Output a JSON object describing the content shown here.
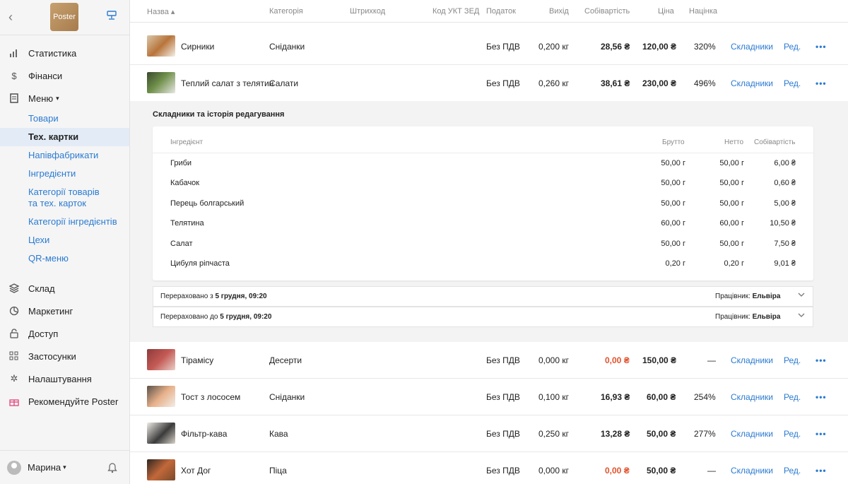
{
  "sidebar": {
    "logo": "Poster",
    "items": [
      {
        "label": "Статистика"
      },
      {
        "label": "Фінанси"
      },
      {
        "label": "Меню"
      },
      {
        "label": "Склад"
      },
      {
        "label": "Маркетинг"
      },
      {
        "label": "Доступ"
      },
      {
        "label": "Застосунки"
      },
      {
        "label": "Налаштування"
      },
      {
        "label": "Рекомендуйте Poster"
      }
    ],
    "menu_sub": [
      {
        "label": "Товари"
      },
      {
        "label": "Тех. картки"
      },
      {
        "label": "Напівфабрикати"
      },
      {
        "label": "Інгредієнти"
      },
      {
        "label": "Категорії товарів та тех. карток"
      },
      {
        "label": "Категорії інгредієнтів"
      },
      {
        "label": "Цехи"
      },
      {
        "label": "QR-меню"
      }
    ],
    "user": "Марина",
    "menu_caret": "▾",
    "user_caret": "▾"
  },
  "table": {
    "columns": {
      "name": "Назва ▴",
      "category": "Категорія",
      "barcode": "Штрихкод",
      "ukt": "Код УКТ ЗЕД",
      "tax": "Податок",
      "yield": "Вихід",
      "cost": "Собівартість",
      "price": "Ціна",
      "markup": "Націнка"
    },
    "rows": [
      {
        "name": "Сирники",
        "category": "Сніданки",
        "tax": "Без ПДВ",
        "yield": "0,200 кг",
        "cost": "28,56 ₴",
        "price": "120,00 ₴",
        "markup": "320%",
        "ingredients": "Складники",
        "edit": "Ред.",
        "more": "•••"
      },
      {
        "name": "Теплий салат з телятин",
        "category": "Салати",
        "tax": "Без ПДВ",
        "yield": "0,260 кг",
        "cost": "38,61 ₴",
        "price": "230,00 ₴",
        "markup": "496%",
        "ingredients": "Складники",
        "edit": "Ред.",
        "more": "•••"
      },
      {
        "name": "Тірамісу",
        "category": "Десерти",
        "tax": "Без ПДВ",
        "yield": "0,000 кг",
        "cost": "0,00 ₴",
        "price": "150,00 ₴",
        "markup": "—",
        "ingredients": "Складники",
        "edit": "Ред.",
        "more": "•••"
      },
      {
        "name": "Тост з лососем",
        "category": "Сніданки",
        "tax": "Без ПДВ",
        "yield": "0,100 кг",
        "cost": "16,93 ₴",
        "price": "60,00 ₴",
        "markup": "254%",
        "ingredients": "Складники",
        "edit": "Ред.",
        "more": "•••"
      },
      {
        "name": "Фільтр-кава",
        "category": "Кава",
        "tax": "Без ПДВ",
        "yield": "0,250 кг",
        "cost": "13,28 ₴",
        "price": "50,00 ₴",
        "markup": "277%",
        "ingredients": "Складники",
        "edit": "Ред.",
        "more": "•••"
      },
      {
        "name": "Хот Дог",
        "category": "Піца",
        "tax": "Без ПДВ",
        "yield": "0,000 кг",
        "cost": "0,00 ₴",
        "price": "50,00 ₴",
        "markup": "—",
        "ingredients": "Складники",
        "edit": "Ред.",
        "more": "•••"
      }
    ]
  },
  "expanded": {
    "title": "Складники та історія редагування",
    "columns": {
      "ingredient": "Інгредієнт",
      "gross": "Брутто",
      "net": "Нетто",
      "cost": "Собівартість"
    },
    "ingredients": [
      {
        "name": "Гриби",
        "gross": "50,00 г",
        "net": "50,00 г",
        "cost": "6,00 ₴"
      },
      {
        "name": "Кабачок",
        "gross": "50,00 г",
        "net": "50,00 г",
        "cost": "0,60 ₴"
      },
      {
        "name": "Перець болгарський",
        "gross": "50,00 г",
        "net": "50,00 г",
        "cost": "5,00 ₴"
      },
      {
        "name": "Телятина",
        "gross": "60,00 г",
        "net": "60,00 г",
        "cost": "10,50 ₴"
      },
      {
        "name": "Салат",
        "gross": "50,00 г",
        "net": "50,00 г",
        "cost": "7,50 ₴"
      },
      {
        "name": "Цибуля ріпчаста",
        "gross": "0,20 г",
        "net": "0,20 г",
        "cost": "9,01 ₴"
      }
    ],
    "history": [
      {
        "prefix": "Перераховано з",
        "date": "5 грудня, 09:20",
        "worker_label": "Працівник:",
        "worker": "Ельвіра"
      },
      {
        "prefix": "Перераховано до",
        "date": "5 грудня, 09:20",
        "worker_label": "Працівник:",
        "worker": "Ельвіра"
      }
    ]
  },
  "colors": {
    "accent": "#2b7bd1",
    "negative": "#e0522c",
    "active_bg": "#e3ebf6"
  }
}
